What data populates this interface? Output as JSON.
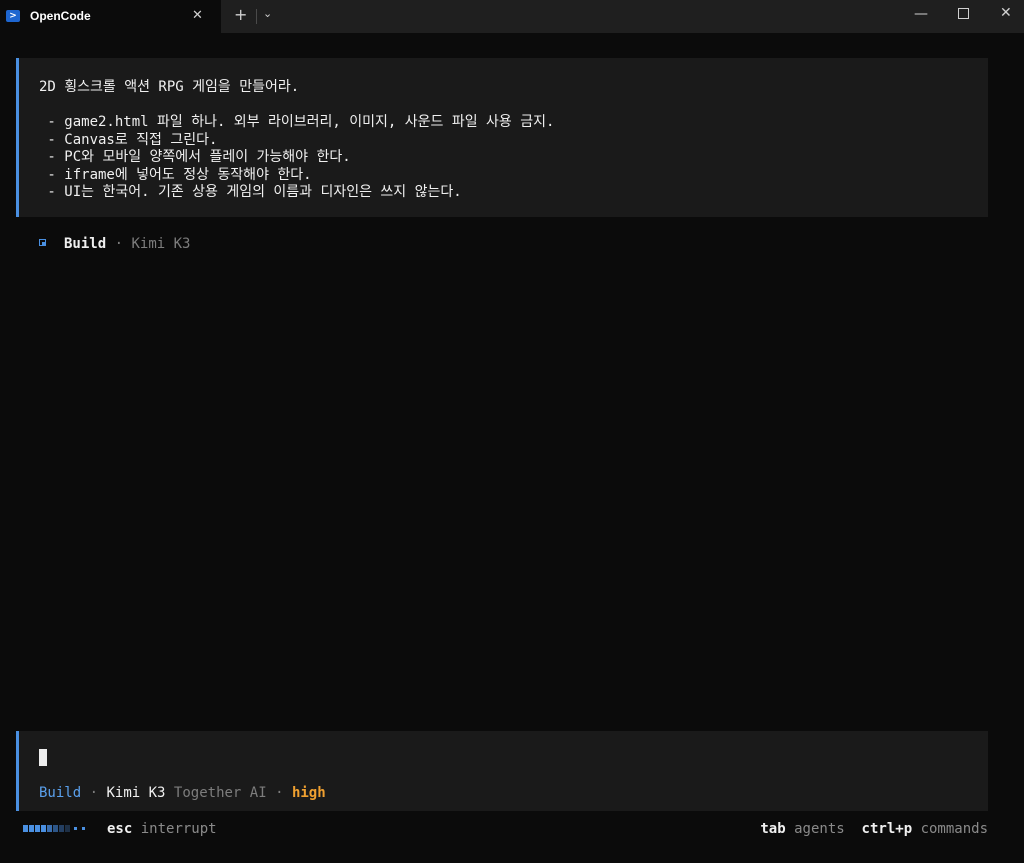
{
  "window": {
    "tab_title": "OpenCode",
    "tab_icon": "powershell-icon",
    "close_tab": "✕",
    "new_tab": "+",
    "dropdown": "⌄",
    "minimize": "—",
    "close": "✕"
  },
  "prompt": {
    "lines": [
      "2D 횡스크롤 액션 RPG 게임을 만들어라.",
      "",
      " - game2.html 파일 하나. 외부 라이브러리, 이미지, 사운드 파일 사용 금지.",
      " - Canvas로 직접 그린다.",
      " - PC와 모바일 양쪽에서 플레이 가능해야 한다.",
      " - iframe에 넣어도 정상 동작해야 한다.",
      " - UI는 한국어. 기존 상용 게임의 이름과 디자인은 쓰지 않는다."
    ]
  },
  "build": {
    "mode": "Build",
    "separator": "·",
    "model": "Kimi K3"
  },
  "input": {
    "mode": "Build",
    "separator": "·",
    "model": "Kimi K3",
    "provider": "Together AI",
    "separator2": "·",
    "effort": "high"
  },
  "footer": {
    "interrupt_key": "esc",
    "interrupt_label": "interrupt",
    "agents_key": "tab",
    "agents_label": "agents",
    "commands_key": "ctrl+p",
    "commands_label": "commands"
  },
  "colors": {
    "accent": "#4a90e2",
    "effort": "#f0a030",
    "background": "#0b0b0b",
    "panel": "#1a1a1a"
  }
}
